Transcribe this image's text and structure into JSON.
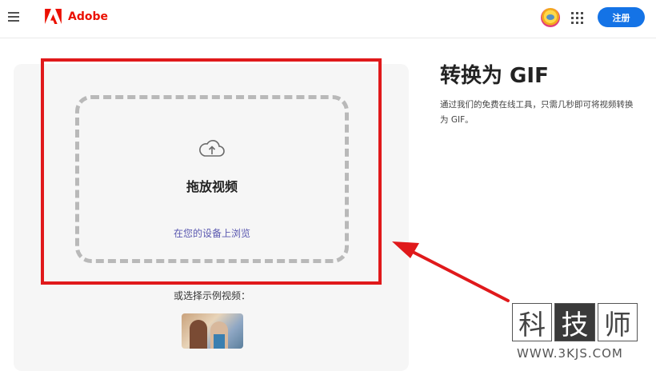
{
  "header": {
    "brand": "Adobe",
    "signup_label": "注册"
  },
  "upload": {
    "title": "拖放视频",
    "browse_link": "在您的设备上浏览",
    "sample_label": "或选择示例视频："
  },
  "info": {
    "title": "转换为 GIF",
    "description": "通过我们的免费在线工具，只需几秒即可将视频转换为 GIF。"
  },
  "watermark": {
    "chars": [
      "科",
      "技",
      "师"
    ],
    "url": "WWW.3KJS.COM"
  },
  "colors": {
    "adobe_red": "#eb1000",
    "primary_blue": "#1473e6",
    "annotation_red": "#e0191b",
    "link": "#5a58b0"
  },
  "icons": {
    "menu": "hamburger-icon",
    "apps": "app-grid-icon",
    "upload": "cloud-upload-icon"
  }
}
